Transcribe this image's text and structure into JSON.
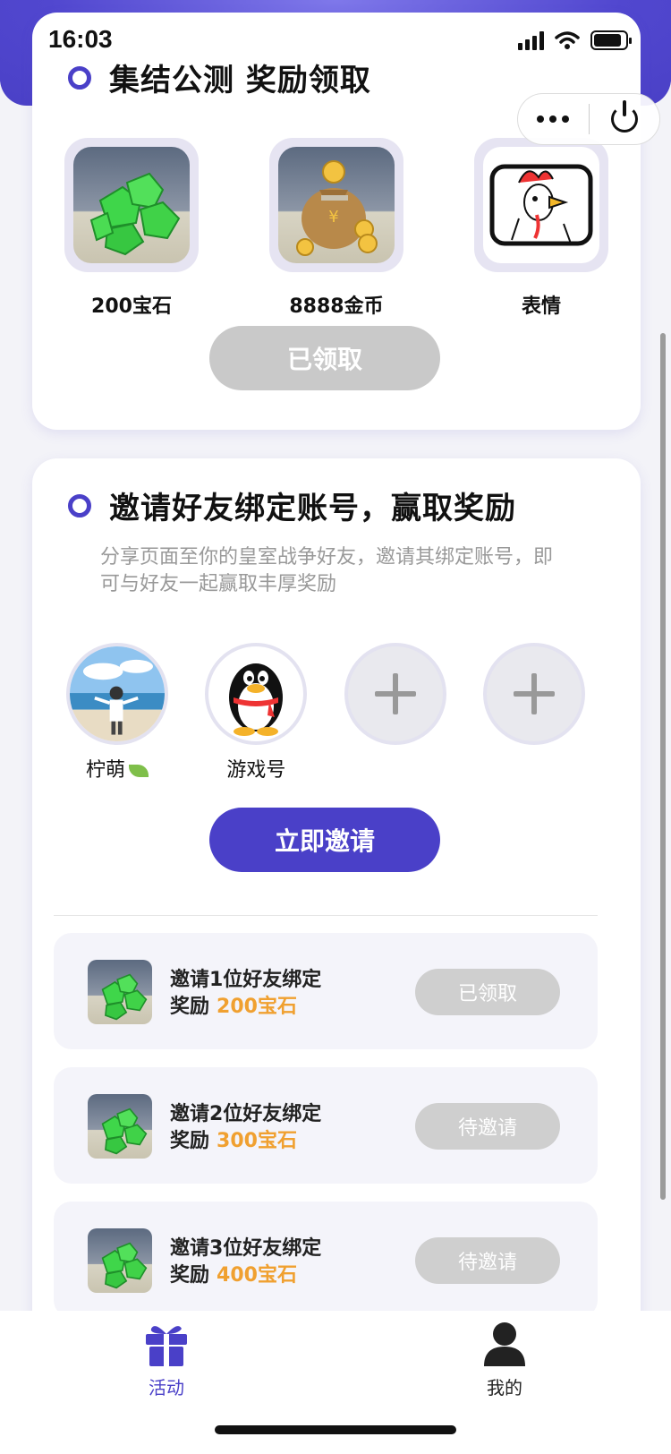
{
  "status_bar": {
    "time": "16:03"
  },
  "colors": {
    "accent": "#4a40c8",
    "highlight": "#f0a030",
    "disabled": "#c9c9c9"
  },
  "section_reward": {
    "title": "集结公测 奖励领取",
    "items": [
      {
        "name": "200宝石",
        "icon": "gems-icon"
      },
      {
        "name": "8888金币",
        "icon": "coin-bag-icon"
      },
      {
        "name": "表情",
        "icon": "chicken-emote-icon"
      }
    ],
    "button": "已领取"
  },
  "section_invite": {
    "title": "邀请好友绑定账号，赢取奖励",
    "description": "分享页面至你的皇室战争好友，邀请其绑定账号，即可与好友一起赢取丰厚奖励",
    "friends": [
      {
        "label": "柠萌",
        "avatar": "user-photo"
      },
      {
        "label": "游戏号",
        "avatar": "qq-penguin-icon"
      },
      {
        "label": "",
        "avatar": "add-icon"
      },
      {
        "label": "",
        "avatar": "add-icon"
      }
    ],
    "invite_button": "立即邀请",
    "tiers": [
      {
        "line1": "邀请1位好友绑定",
        "prefix": "奖励",
        "amount": "200宝石",
        "state": "已领取"
      },
      {
        "line1": "邀请2位好友绑定",
        "prefix": "奖励",
        "amount": "300宝石",
        "state": "待邀请"
      },
      {
        "line1": "邀请3位好友绑定",
        "prefix": "奖励",
        "amount": "400宝石",
        "state": "待邀请"
      }
    ]
  },
  "tabbar": {
    "tabs": [
      {
        "label": "活动",
        "icon": "gift-icon",
        "active": true
      },
      {
        "label": "我的",
        "icon": "person-icon",
        "active": false
      }
    ]
  }
}
